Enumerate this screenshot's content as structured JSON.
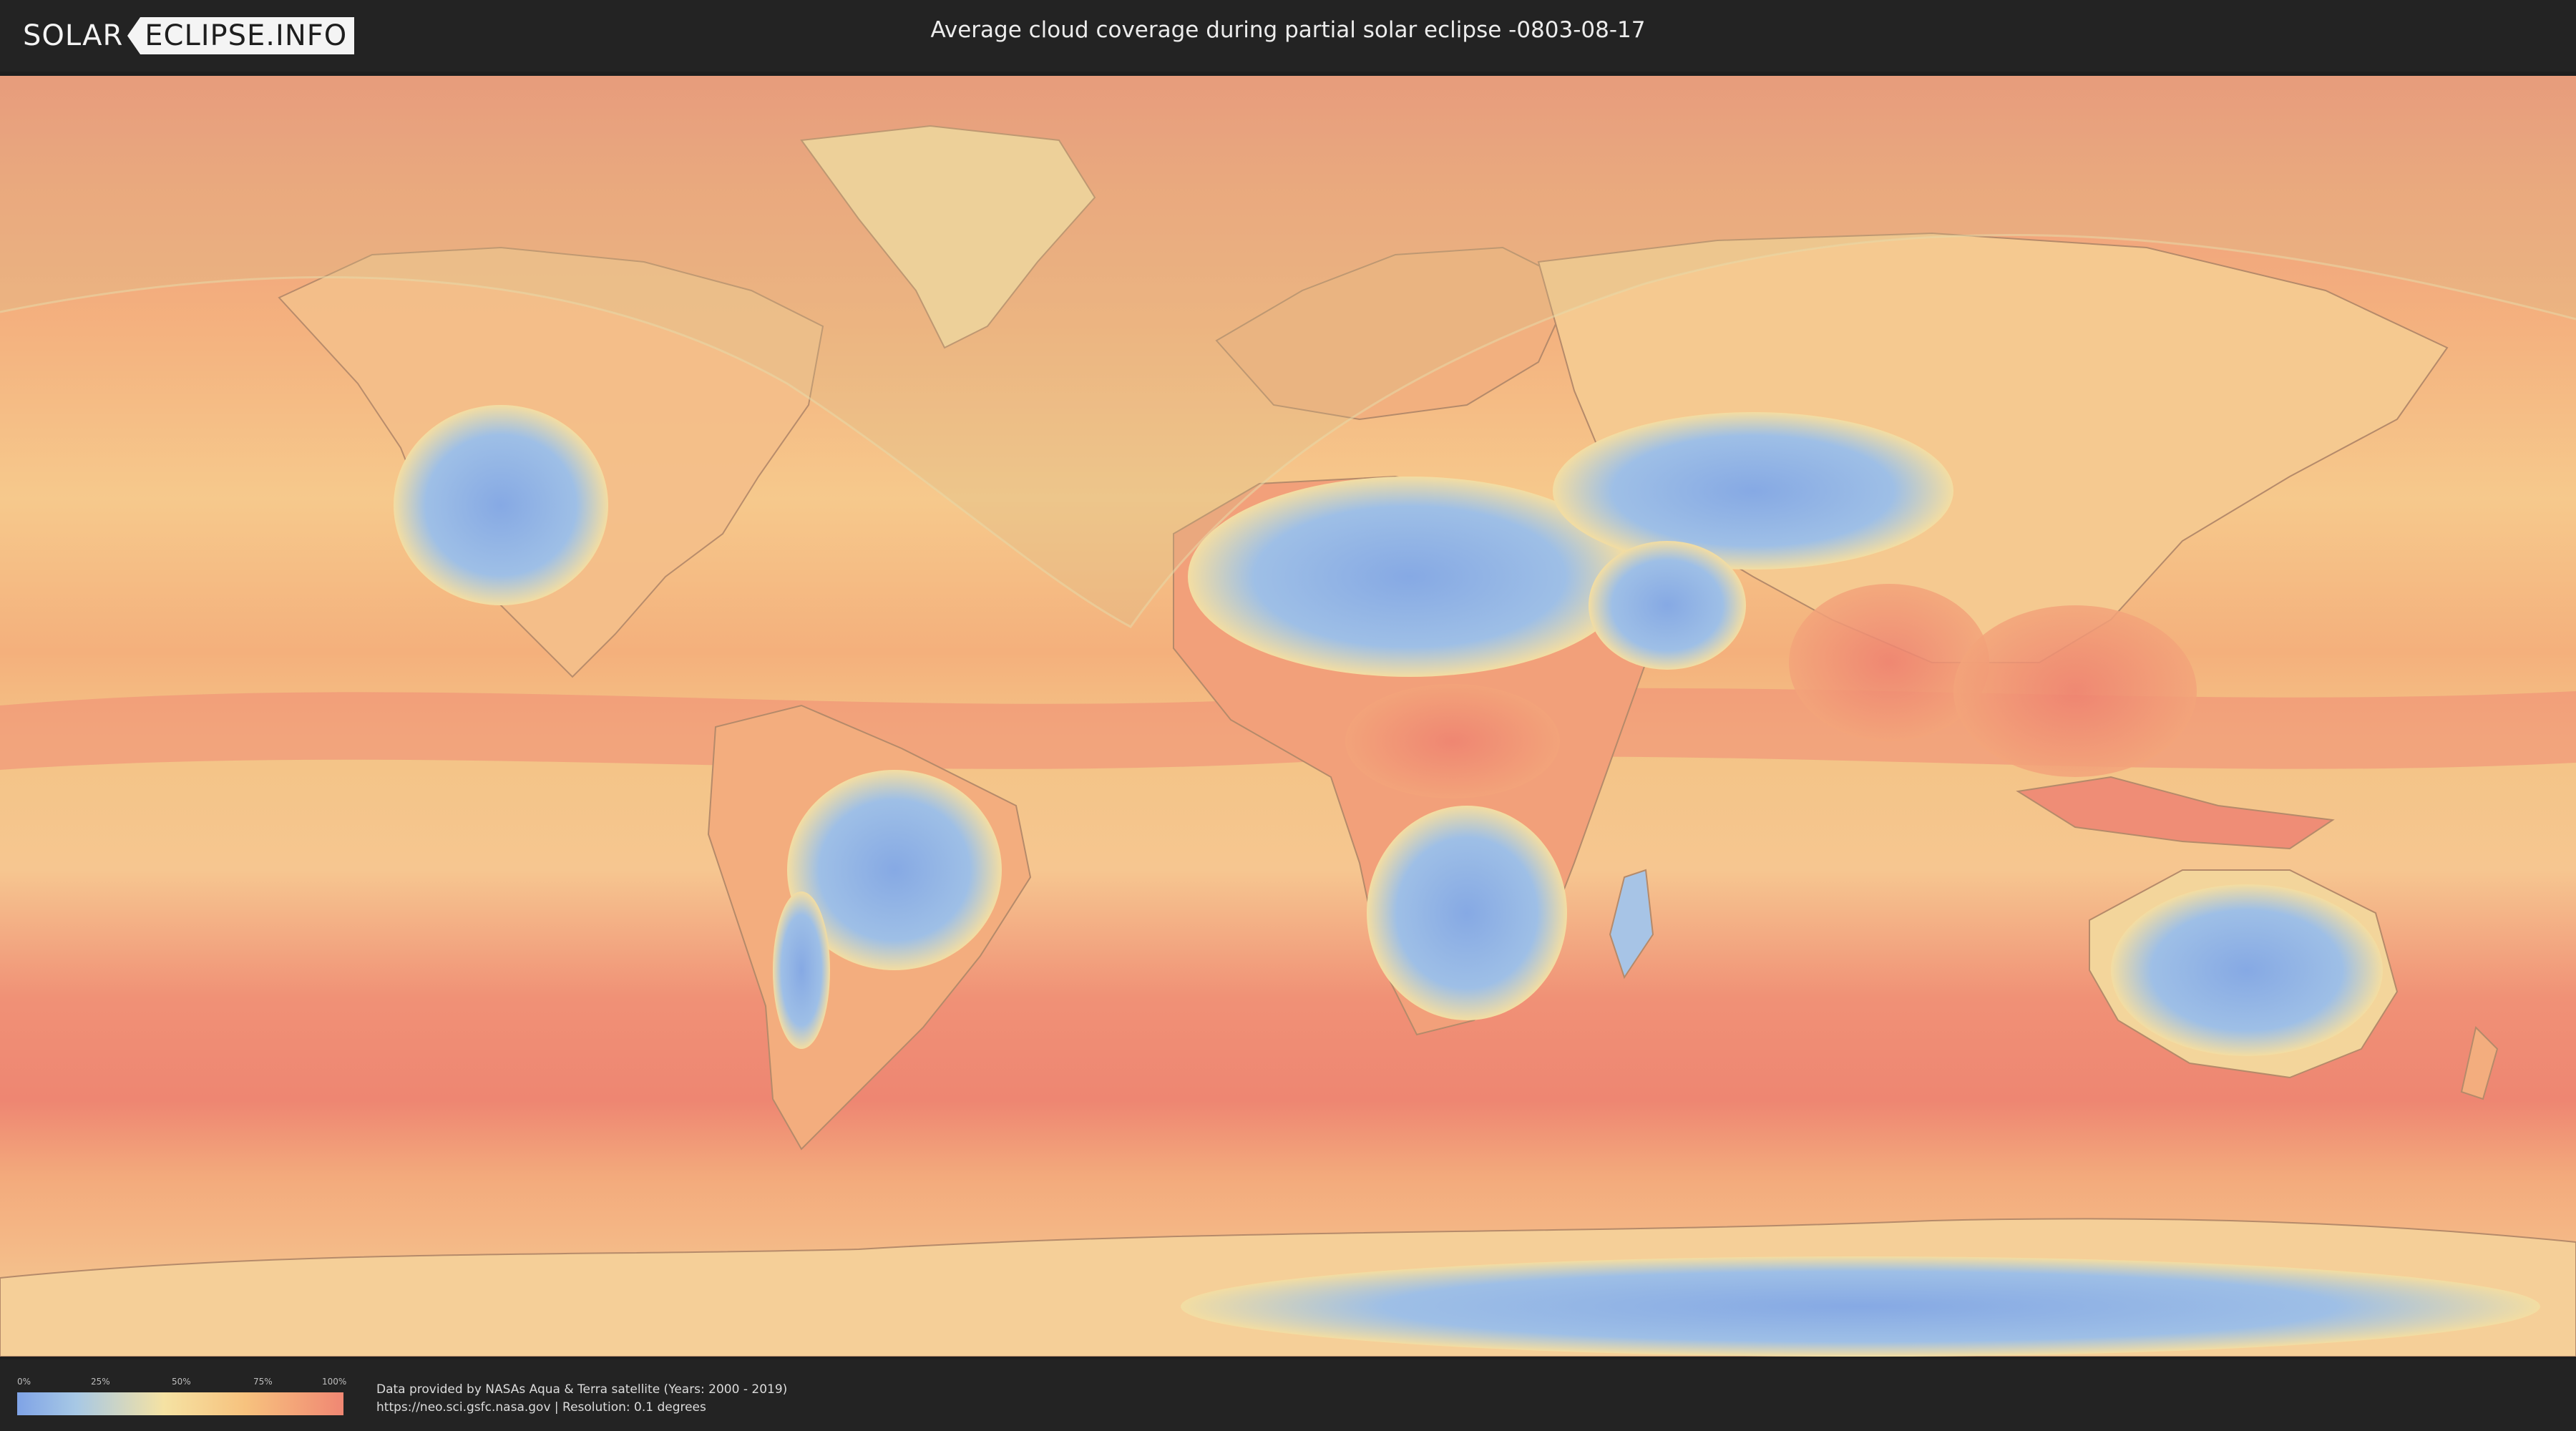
{
  "header": {
    "logo_left": "SOLAR",
    "logo_right": "ECLIPSE.INFO",
    "title": "Average cloud coverage during partial solar eclipse -0803-08-17"
  },
  "legend": {
    "ticks": [
      "0%",
      "25%",
      "50%",
      "75%",
      "100%"
    ],
    "colors": [
      "#7fa3e6",
      "#a7c8e5",
      "#f5e2a3",
      "#f7c27e",
      "#f08773"
    ]
  },
  "footer": {
    "credit_line1": "Data provided by NASAs Aqua & Terra satellite (Years: 2000 - 2019)",
    "credit_line2": "https://neo.sci.gsfc.nasa.gov | Resolution: 0.1 degrees"
  },
  "map": {
    "projection": "equirectangular",
    "ocean_color": "#f2a476",
    "eclipse_overlay": "shaded partial eclipse visibility band"
  }
}
